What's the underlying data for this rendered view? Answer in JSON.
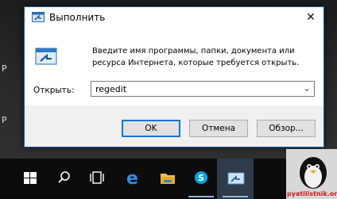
{
  "dialog": {
    "title": "Выполнить",
    "description": "Введите имя программы, папки, документа или ресурса Интернета, которые требуется открыть.",
    "open_label": "Открыть:",
    "open_value": "regedit",
    "buttons": {
      "ok": "OK",
      "cancel": "Отмена",
      "browse": "Обзор..."
    },
    "close_glyph": "✕"
  },
  "taskbar": {
    "icons": [
      "windows-start-icon",
      "search-icon",
      "task-view-icon",
      "edge-icon",
      "file-explorer-icon",
      "skype-icon",
      "run-app-icon"
    ]
  },
  "watermark": {
    "text": "pyatilistnik.org"
  },
  "colors": {
    "accent": "#0078d7",
    "taskbar": "#0c0c0c"
  }
}
